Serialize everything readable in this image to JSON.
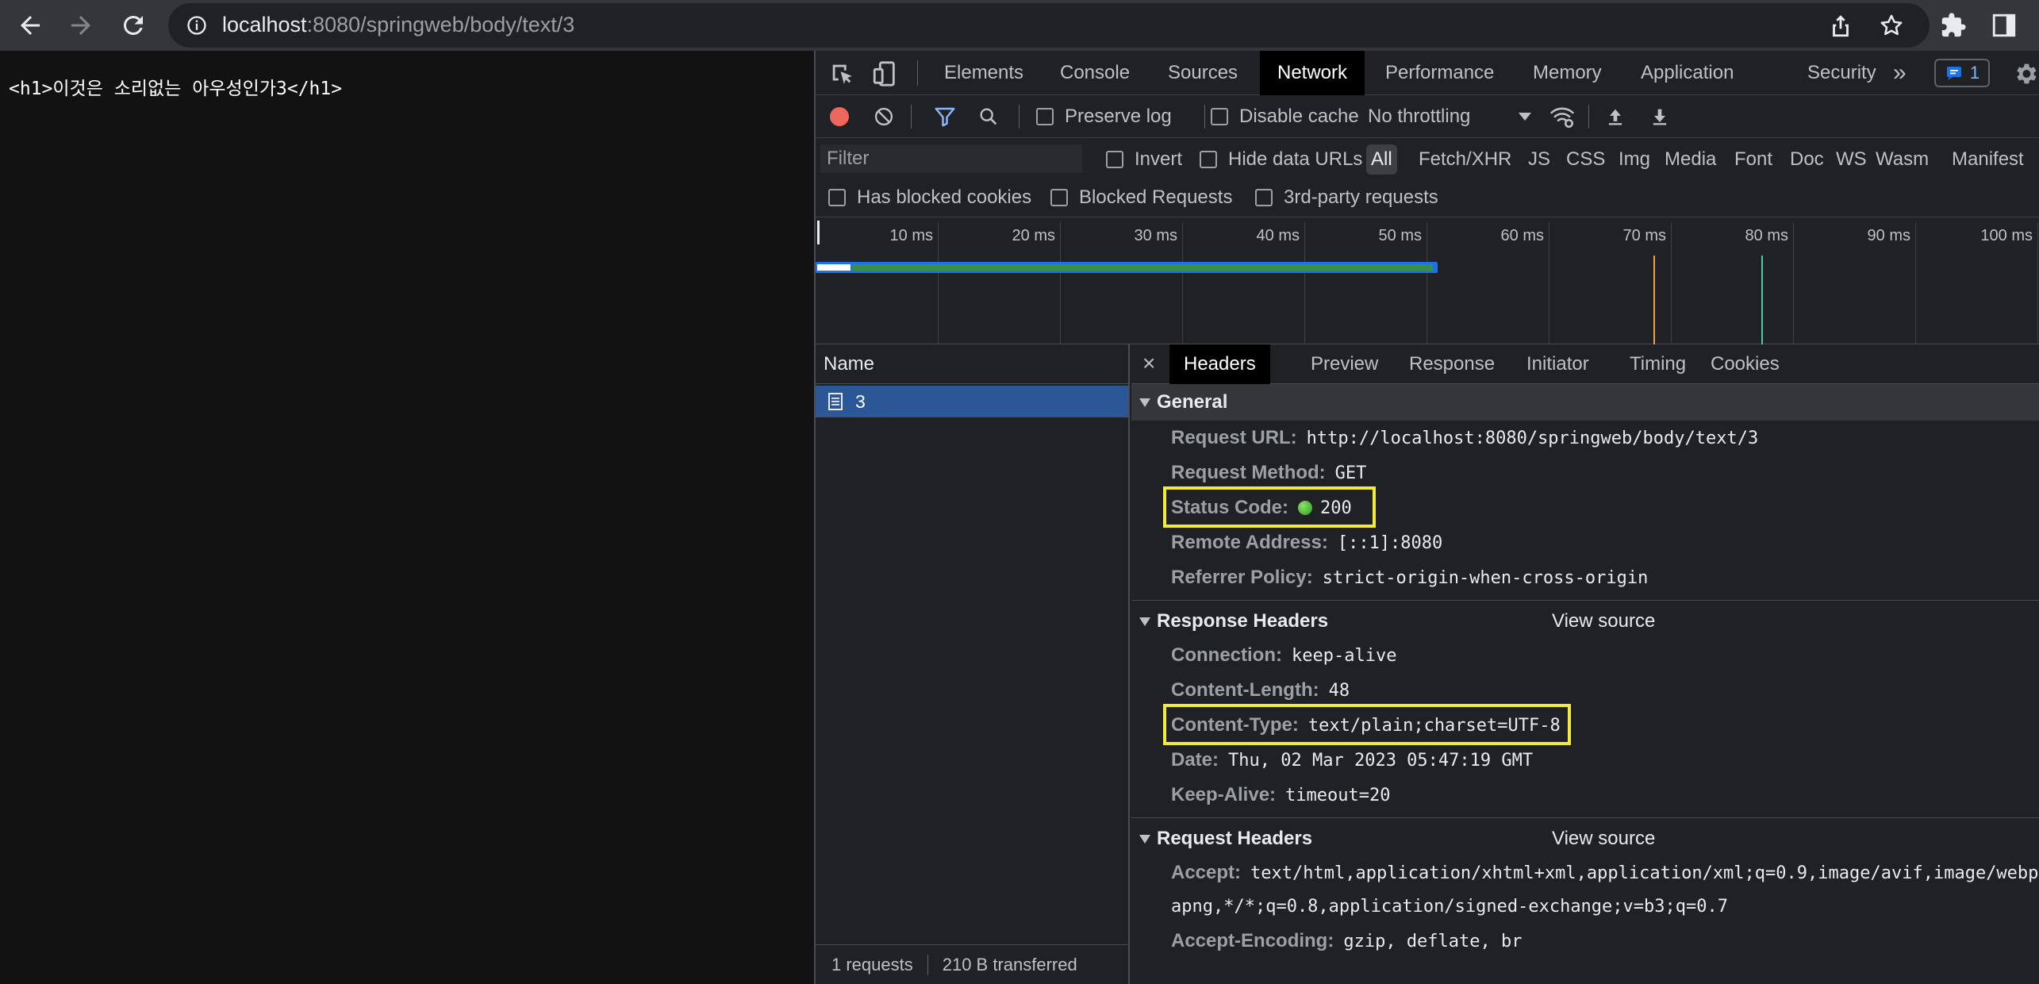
{
  "browser": {
    "url_host": "localhost",
    "url_rest": ":8080/springweb/body/text/3"
  },
  "page": {
    "content": "<h1>이것은 소리없는 아우성인가3</h1>"
  },
  "devtools": {
    "tabs": [
      "Elements",
      "Console",
      "Sources",
      "Network",
      "Performance",
      "Memory",
      "Application",
      "Security"
    ],
    "active_tab": "Network",
    "more_tabs": "»",
    "issues_count": "1",
    "toolbar": {
      "preserve_log": "Preserve log",
      "disable_cache": "Disable cache",
      "throttling": "No throttling"
    },
    "filter": {
      "placeholder": "Filter",
      "invert": "Invert",
      "hide_data_urls": "Hide data URLs",
      "types": [
        "All",
        "Fetch/XHR",
        "JS",
        "CSS",
        "Img",
        "Media",
        "Font",
        "Doc",
        "WS",
        "Wasm",
        "Manifest"
      ],
      "active_type": "All",
      "has_blocked_cookies": "Has blocked cookies",
      "blocked_requests": "Blocked Requests",
      "third_party": "3rd-party requests"
    },
    "timeline": {
      "ticks": [
        "10 ms",
        "20 ms",
        "30 ms",
        "40 ms",
        "50 ms",
        "60 ms",
        "70 ms",
        "80 ms",
        "90 ms",
        "100 ms"
      ],
      "colors": {
        "bar": "#3c8f4a",
        "bar_border": "#1a73e8",
        "dcl": "#e8a34a",
        "load": "#4ec9b0"
      }
    },
    "requests": {
      "column_name": "Name",
      "rows": [
        {
          "name": "3"
        }
      ],
      "footer_requests": "1 requests",
      "footer_transferred": "210 B transferred"
    },
    "detail": {
      "close": "×",
      "tabs": [
        "Headers",
        "Preview",
        "Response",
        "Initiator",
        "Timing",
        "Cookies"
      ],
      "active_tab": "Headers",
      "general": {
        "title": "General",
        "request_url_key": "Request URL:",
        "request_url": "http://localhost:8080/springweb/body/text/3",
        "request_method_key": "Request Method:",
        "request_method": "GET",
        "status_code_key": "Status Code:",
        "status_code": "200",
        "remote_address_key": "Remote Address:",
        "remote_address": "[::1]:8080",
        "referrer_policy_key": "Referrer Policy:",
        "referrer_policy": "strict-origin-when-cross-origin"
      },
      "response_headers": {
        "title": "Response Headers",
        "view_source": "View source",
        "connection_key": "Connection:",
        "connection": "keep-alive",
        "content_length_key": "Content-Length:",
        "content_length": "48",
        "content_type_key": "Content-Type:",
        "content_type": "text/plain;charset=UTF-8",
        "date_key": "Date:",
        "date": "Thu, 02 Mar 2023 05:47:19 GMT",
        "keep_alive_key": "Keep-Alive:",
        "keep_alive": "timeout=20"
      },
      "request_headers": {
        "title": "Request Headers",
        "view_source": "View source",
        "accept_key": "Accept:",
        "accept": "text/html,application/xhtml+xml,application/xml;q=0.9,image/avif,image/webp",
        "accept_cont": "apng,*/*;q=0.8,application/signed-exchange;v=b3;q=0.7",
        "accept_encoding_key": "Accept-Encoding:",
        "accept_encoding": "gzip, deflate, br"
      }
    }
  }
}
